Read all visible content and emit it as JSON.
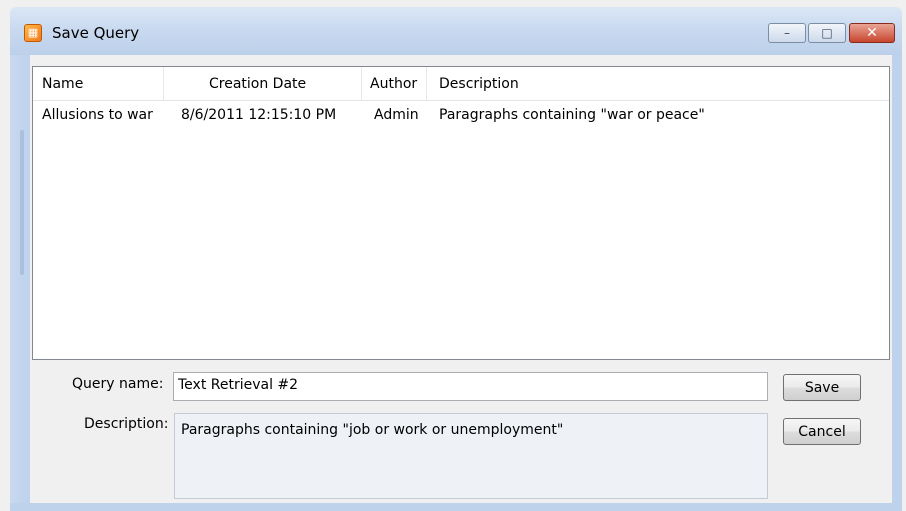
{
  "window": {
    "title": "Save Query",
    "icon": "save-query-app-icon",
    "controls": {
      "minimize": "–",
      "maximize": "□",
      "close": "✕"
    }
  },
  "list": {
    "columns": [
      "Name",
      "Creation Date",
      "Author",
      "Description"
    ],
    "rows": [
      {
        "name": "Allusions to war",
        "creation_date": "8/6/2011 12:15:10 PM",
        "author": "Admin",
        "description": "Paragraphs containing \"war or peace\""
      }
    ]
  },
  "form": {
    "query_name_label": "Query name:",
    "query_name_value": "Text Retrieval #2",
    "description_label": "Description:",
    "description_value": "Paragraphs containing \"job or work or unemployment\""
  },
  "buttons": {
    "save": "Save",
    "cancel": "Cancel"
  }
}
